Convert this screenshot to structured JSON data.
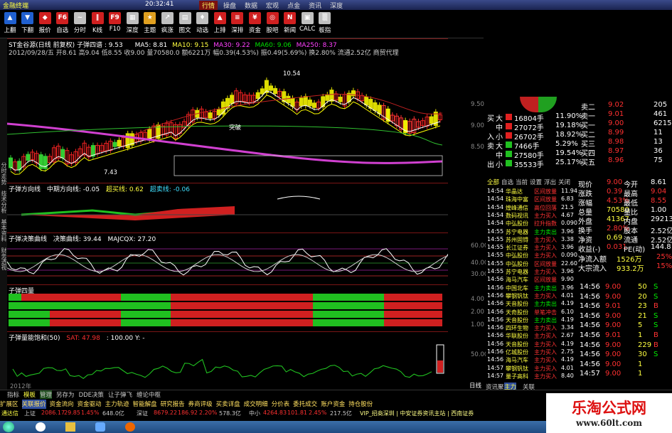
{
  "title_bar": {
    "app_name": "金融终端",
    "clock": "20:32:41"
  },
  "top_tabs": [
    "行情",
    "操盘",
    "数据",
    "宏观",
    "点金",
    "资讯",
    "深度"
  ],
  "toolbar": [
    {
      "icon": "arrow-up-icon",
      "label": "上翻",
      "color": "#2060d0",
      "glyph": "▲"
    },
    {
      "icon": "arrow-down-icon",
      "label": "下翻",
      "color": "#2060d0",
      "glyph": "▼"
    },
    {
      "icon": "quote-icon",
      "label": "报价",
      "color": "#d02020",
      "glyph": "◆"
    },
    {
      "icon": "watchlist-icon",
      "label": "自选",
      "color": "#d02020",
      "glyph": "F6"
    },
    {
      "icon": "timeshare-icon",
      "label": "分时",
      "color": "#c0c0c0",
      "glyph": "~"
    },
    {
      "icon": "kline-icon",
      "label": "K线",
      "color": "#d02020",
      "glyph": "‖"
    },
    {
      "icon": "f10-icon",
      "label": "F10",
      "color": "#d02020",
      "glyph": "F9"
    },
    {
      "icon": "depth-icon",
      "label": "深度",
      "color": "#c0c0c0",
      "glyph": "▦"
    },
    {
      "icon": "theme-icon",
      "label": "主题",
      "color": "#e0a020",
      "glyph": "★"
    },
    {
      "icon": "clue-icon",
      "label": "疯涨",
      "color": "#c0c0c0",
      "glyph": "↗"
    },
    {
      "icon": "chart-icon",
      "label": "图文",
      "color": "#c0c0c0",
      "glyph": "▤"
    },
    {
      "icon": "motion-icon",
      "label": "动选",
      "color": "#c0c0c0",
      "glyph": "♦"
    },
    {
      "icon": "rank-icon",
      "label": "上排",
      "color": "#d02020",
      "glyph": "▲"
    },
    {
      "icon": "deep-icon",
      "label": "深排",
      "color": "#d02020",
      "glyph": "≡"
    },
    {
      "icon": "fund-icon",
      "label": "资金",
      "color": "#d02020",
      "glyph": "¥"
    },
    {
      "icon": "stock-news-icon",
      "label": "股吧",
      "color": "#d02020",
      "glyph": "◎"
    },
    {
      "icon": "news-icon",
      "label": "新闻",
      "color": "#d02020",
      "glyph": "N"
    },
    {
      "icon": "calc-icon",
      "label": "CALC",
      "color": "#c0c0c0",
      "glyph": "▣"
    },
    {
      "icon": "board-icon",
      "label": "板指",
      "color": "#c0c0c0",
      "glyph": "▒"
    }
  ],
  "left_side_tabs": [
    "分时走势",
    "技术分析",
    "基本资料",
    "财务透视"
  ],
  "main_chart": {
    "header1": "ST金谷源(日线 前复权) 子弹四谱 : 9.53",
    "ma5": "MA5: 8.81",
    "ma10": "MA10: 9.15",
    "ma30": "MA30: 9.22",
    "ma60": "MA60: 9.06",
    "ma250": "MA250: 8.37",
    "info_line": "2012/09/28/五 开8.61 高9.04 低8.55 收9.00 量70580.0 额6221万 幅0.39(4.53%) 振0.49(5.69%) 换2.80% 流通2.52亿 商贸代理",
    "high_label": "10.54",
    "low_label": "7.43",
    "break_label": "突破",
    "axis": [
      "9.50",
      "9.00",
      "8.50"
    ]
  },
  "panel1": {
    "title": "子弹方向线",
    "mid": "中期方向线: -0.05",
    "buy": "超买线: 0.62",
    "sell": "超卖线: -0.06"
  },
  "panel2": {
    "title": "子弹决策曲线",
    "a": "决策曲线: 39.44",
    "b": "MAJCQX: 27.20",
    "axis": [
      "60.00",
      "40.00",
      "30.00"
    ]
  },
  "panel3": {
    "title": "子弹四量",
    "axis": [
      "4.00",
      "2.00",
      "1.00"
    ]
  },
  "panel4": {
    "title": "子弹量能饱和(50)",
    "sat": "SAT: 47.98",
    "extra": ": 100.00 Y: -",
    "axis": [
      "50.00"
    ],
    "year": "2012年"
  },
  "order_book": {
    "sells": [
      {
        "label": "卖二",
        "price": "9.02",
        "vol": "205"
      },
      {
        "label": "卖一",
        "price": "9.01",
        "vol": "461"
      },
      {
        "label": "买一",
        "price": "9.00",
        "vol": "6215"
      },
      {
        "label": "买二",
        "price": "8.99",
        "vol": "11"
      },
      {
        "label": "买三",
        "price": "8.98",
        "vol": "13"
      },
      {
        "label": "买四",
        "price": "8.97",
        "vol": "36"
      },
      {
        "label": "买五",
        "price": "8.96",
        "vol": "75"
      }
    ],
    "flow": [
      {
        "side": "买",
        "size": "大",
        "vol": "16804手",
        "pct": "11.90%"
      },
      {
        "side": "",
        "size": "中",
        "vol": "27072手",
        "pct": "19.18%"
      },
      {
        "side": "入",
        "size": "小",
        "vol": "26702手",
        "pct": "18.92%"
      },
      {
        "side": "卖",
        "size": "大",
        "vol": "7466手",
        "pct": "5.29%"
      },
      {
        "side": "",
        "size": "中",
        "vol": "27580手",
        "pct": "19.54%"
      },
      {
        "side": "出",
        "size": "小",
        "vol": "35533手",
        "pct": "25.17%"
      }
    ]
  },
  "quote": [
    {
      "k1": "现价",
      "v1": "9.00",
      "k2": "今开",
      "v2": "8.61"
    },
    {
      "k1": "涨跌",
      "v1": "0.39",
      "k2": "最高",
      "v2": "9.04"
    },
    {
      "k1": "涨幅",
      "v1": "4.53%",
      "k2": "最低",
      "v2": "8.55"
    },
    {
      "k1": "总量",
      "v1": "70580",
      "k2": "量比",
      "v2": "1.00"
    },
    {
      "k1": "外盘",
      "v1": "41367",
      "k2": "内盘",
      "v2": "29213"
    },
    {
      "k1": "换手",
      "v1": "2.80%",
      "k2": "股本",
      "v2": "2.52亿"
    },
    {
      "k1": "净资",
      "v1": "0.69",
      "k2": "流通",
      "v2": "2.52亿"
    },
    {
      "k1": "收益(-)",
      "v1": "0.031",
      "k2": "PE(动)",
      "v2": "144.8"
    }
  ],
  "netflow": [
    {
      "k": "净流入额",
      "v": "1526万",
      "p": "25%"
    },
    {
      "k": "大宗流入",
      "v": "933.2万",
      "p": "15%"
    }
  ],
  "tabs_right": [
    "全部",
    "自选",
    "当前",
    "设置",
    "浮出",
    "关闭"
  ],
  "ticks": [
    {
      "t": "14:54",
      "name": "华晶达",
      "act": "区间放量",
      "v": "11.94"
    },
    {
      "t": "14:54",
      "name": "珠海中富",
      "act": "区间放量",
      "v": "6.83"
    },
    {
      "t": "14:54",
      "name": "煌峰通信",
      "act": "高位回落",
      "v": "21.5"
    },
    {
      "t": "14:54",
      "name": "数码视讯",
      "act": "主力买入",
      "v": "4.67"
    },
    {
      "t": "14:54",
      "name": "中弘股份",
      "act": "拉升指数",
      "v": "0.090"
    },
    {
      "t": "14:55",
      "name": "苏宁电器",
      "act": "主力卖出",
      "v": "3.96"
    },
    {
      "t": "14:55",
      "name": "苏州固锝",
      "act": "主力买入",
      "v": "3.38"
    },
    {
      "t": "14:55",
      "name": "长江证券",
      "act": "主力买入",
      "v": "3.96"
    },
    {
      "t": "14:55",
      "name": "中弘股份",
      "act": "主力买入",
      "v": "0.090"
    },
    {
      "t": "14:55",
      "name": "中弘股份",
      "act": "区间放量",
      "v": "22.60"
    },
    {
      "t": "14:55",
      "name": "苏宁电器",
      "act": "主力买入",
      "v": "3.96"
    },
    {
      "t": "14:56",
      "name": "海马汽车",
      "act": "区间放量",
      "v": "9.90"
    },
    {
      "t": "14:56",
      "name": "中国北车",
      "act": "主力卖出",
      "v": "3.96"
    },
    {
      "t": "14:56",
      "name": "攀钢钒钛",
      "act": "主力买入",
      "v": "4.01"
    },
    {
      "t": "14:56",
      "name": "天音股份",
      "act": "主力卖出",
      "v": "4.19"
    },
    {
      "t": "14:56",
      "name": "天奇股份",
      "act": "单笔冲击",
      "v": "6.10"
    },
    {
      "t": "14:56",
      "name": "天音股份",
      "act": "主力卖出",
      "v": "4.19"
    },
    {
      "t": "14:56",
      "name": "四环生物",
      "act": "主力买入",
      "v": "3.34"
    },
    {
      "t": "14:56",
      "name": "华联股份",
      "act": "主力买入",
      "v": "2.67"
    },
    {
      "t": "14:56",
      "name": "天音股份",
      "act": "主力买入",
      "v": "4.19"
    },
    {
      "t": "14:56",
      "name": "亿城股份",
      "act": "主力买入",
      "v": "2.75"
    },
    {
      "t": "14:56",
      "name": "海马汽车",
      "act": "主力买入",
      "v": "4.19"
    },
    {
      "t": "14:57",
      "name": "攀钢钒钛",
      "act": "主力买入",
      "v": "4.01"
    },
    {
      "t": "14:57",
      "name": "量子高科",
      "act": "主力买入",
      "v": "8.40"
    }
  ],
  "trades": [
    {
      "t": "14:56",
      "p": "9.00",
      "v": "50",
      "s": "S"
    },
    {
      "t": "14:56",
      "p": "9.00",
      "v": "20",
      "s": "S"
    },
    {
      "t": "14:56",
      "p": "9.01",
      "v": "23",
      "s": "B"
    },
    {
      "t": "14:56",
      "p": "9.00",
      "v": "21",
      "s": "S"
    },
    {
      "t": "14:56",
      "p": "9.00",
      "v": "5",
      "s": "S"
    },
    {
      "t": "14:56",
      "p": "9.01",
      "v": "1",
      "s": "B"
    },
    {
      "t": "14:56",
      "p": "9.00",
      "v": "229",
      "s": "B"
    },
    {
      "t": "14:56",
      "p": "9.00",
      "v": "30",
      "s": "S"
    },
    {
      "t": "14:56",
      "p": "9.00",
      "v": "1",
      "s": ""
    },
    {
      "t": "14:57",
      "p": "9.00",
      "v": "1",
      "s": ""
    }
  ],
  "right_bottom_tabs": [
    "资讯聚合",
    "主力",
    "关联"
  ],
  "bottom_tabs1": [
    "指标",
    "模板",
    "管理",
    "另存为",
    "DDE决策",
    "让子弹飞",
    "缠论中枢"
  ],
  "bottom_tabs2": [
    "扩展区",
    "关联报价",
    "资金流向",
    "资金驱动",
    "主力轨迹",
    "智能解盘",
    "研究报告",
    "券商评级",
    "买卖详盘",
    "成交明细",
    "分价表",
    "委托成交",
    "账户资金",
    "持仓股份"
  ],
  "daily_label": "日线",
  "status_bar": {
    "index1": "上证",
    "v1": "2086.17",
    "c1": "29.85",
    "p1": "1.45%",
    "a1": "648.0亿",
    "index2": "深证",
    "v2": "8679.22",
    "c2": "186.92",
    "p2": "2.20%",
    "a2": "578.3亿",
    "index3": "中小",
    "v3": "4264.83",
    "c3": "101.81",
    "p3": "2.45%",
    "a3": "217.5亿",
    "ticker": "VIP_招商深圳 | 中安证券资讯主站 | 西南证券"
  },
  "status_label": "通达信",
  "brand": {
    "name": "乐淘公式网",
    "url": "www.60lt.com"
  },
  "colors": {
    "up": "#ff3030",
    "down": "#00e000",
    "frame": "#7a1515",
    "accent": "#ffff40"
  }
}
